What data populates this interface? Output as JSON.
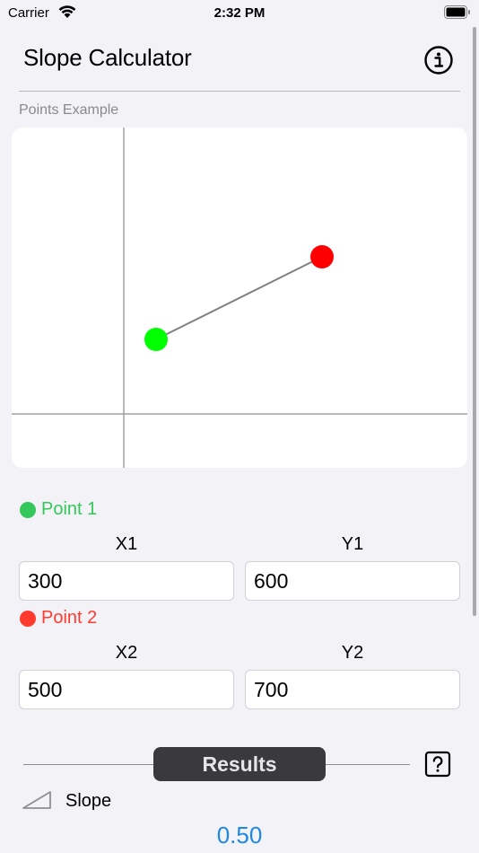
{
  "status_bar": {
    "carrier": "Carrier",
    "time": "2:32 PM"
  },
  "nav": {
    "title": "Slope Calculator",
    "info_icon": "info-circle-icon"
  },
  "graph": {
    "section_label": "Points Example",
    "point1_color": "#00ff00",
    "point2_color": "#ff0000",
    "line_color": "#808080",
    "axis_color": "#a0a0a0"
  },
  "point1": {
    "label": "Point 1",
    "x_header": "X1",
    "y_header": "Y1",
    "x_value": "300",
    "y_value": "600",
    "color": "#34c759"
  },
  "point2": {
    "label": "Point 2",
    "x_header": "X2",
    "y_header": "Y2",
    "x_value": "500",
    "y_value": "700",
    "color": "#ff3b30"
  },
  "results": {
    "button_label": "Results",
    "help_icon": "question-mark-icon",
    "slope_label": "Slope",
    "slope_value": "0.50",
    "value_color": "#1e88e5"
  }
}
